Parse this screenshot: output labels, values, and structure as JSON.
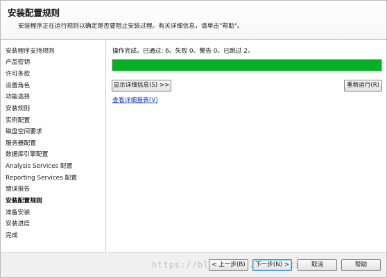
{
  "header": {
    "title": "安装配置规则",
    "description": "安装程序正在运行规则以确定是否要阻止安装过程。有关详细信息，请单击\"帮助\"。"
  },
  "sidebar": {
    "active_step": "安装配置规则",
    "items": [
      {
        "label": "安装程序支持规则"
      },
      {
        "label": "产品密钥"
      },
      {
        "label": "许可条款"
      },
      {
        "label": "设置角色"
      },
      {
        "label": "功能选择"
      },
      {
        "label": "安装规则"
      },
      {
        "label": "实例配置"
      },
      {
        "label": "磁盘空间要求"
      },
      {
        "label": "服务器配置"
      },
      {
        "label": "数据库引擎配置"
      },
      {
        "label": "Analysis Services 配置"
      },
      {
        "label": "Reporting Services 配置"
      },
      {
        "label": "错误报告"
      },
      {
        "label": "安装配置规则"
      },
      {
        "label": "准备安装"
      },
      {
        "label": "安装进度"
      },
      {
        "label": "完成"
      }
    ]
  },
  "main": {
    "status_text": "操作完成。已通过: 6。失败 0。警告 0。已跳过 2。",
    "progress_percent": 100,
    "progress_color": "#06b025",
    "show_details_button": "显示详细信息(S) >>",
    "rerun_button": "重新运行(R)",
    "view_report_link": "查看详细报表(V)"
  },
  "footer": {
    "back_button": "< 上一步(B)",
    "next_button": "下一步(N) >",
    "cancel_button": "取消",
    "help_button": "帮助"
  },
  "watermark": {
    "text": "https://blog.csdn.net/xxxiangbin"
  }
}
